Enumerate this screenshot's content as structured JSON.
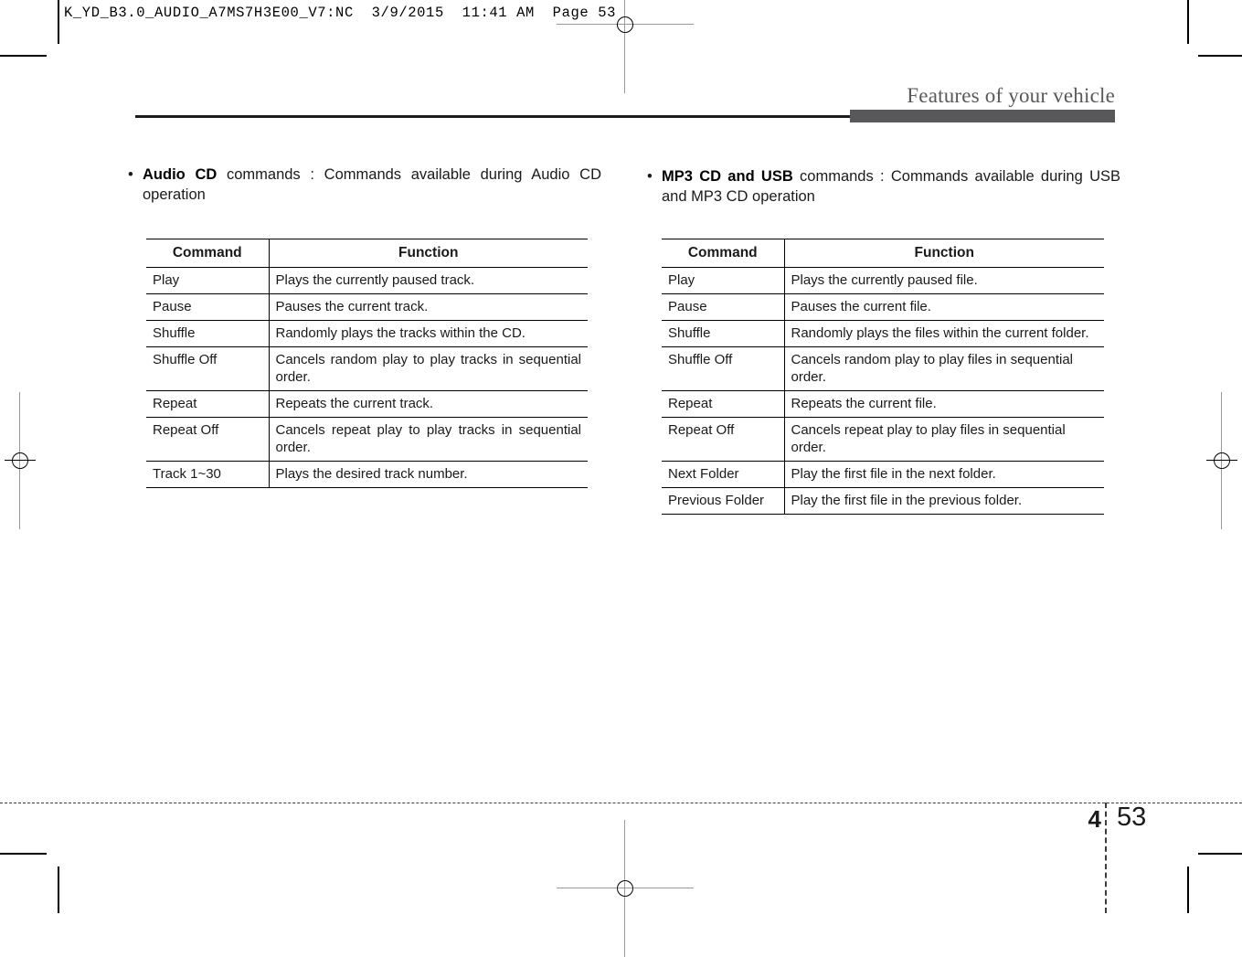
{
  "print_header": "K_YD_B3.0_AUDIO_A7MS7H3E00_V7:NC  3/9/2015  11:41 AM  Page 53",
  "running_head": "Features of your vehicle",
  "footer": {
    "chapter": "4",
    "page": "53"
  },
  "columns": {
    "left": {
      "bullet": "•",
      "lead": "Audio CD",
      "intro_rest": " commands : Commands available during Audio CD operation",
      "intro_full": "Audio CD commands : Commands available during Audio CD operation",
      "table": {
        "headers": [
          "Command",
          "Function"
        ],
        "rows": [
          [
            "Play",
            "Plays the currently paused track."
          ],
          [
            "Pause",
            "Pauses the current track."
          ],
          [
            "Shuffle",
            "Randomly plays the tracks within the CD."
          ],
          [
            "Shuffle Off",
            "Cancels random play to play tracks in sequential order."
          ],
          [
            "Repeat",
            "Repeats the current track."
          ],
          [
            "Repeat Off",
            "Cancels repeat play to play tracks in sequential order."
          ],
          [
            "Track 1~30",
            "Plays the desired track number."
          ]
        ]
      }
    },
    "right": {
      "bullet": "•",
      "lead": "MP3 CD and USB",
      "intro_rest": " commands : Commands available during USB and MP3 CD operation",
      "intro_full": "MP3 CD and USB commands : Commands available during USB and MP3 CD operation",
      "table": {
        "headers": [
          "Command",
          "Function"
        ],
        "rows": [
          [
            "Play",
            "Plays the currently paused file."
          ],
          [
            "Pause",
            "Pauses the current file."
          ],
          [
            "Shuffle",
            "Randomly plays the files within the current folder."
          ],
          [
            "Shuffle Off",
            "Cancels random play to play files in sequential order."
          ],
          [
            "Repeat",
            "Repeats the current file."
          ],
          [
            "Repeat Off",
            "Cancels repeat play to play files in sequential order."
          ],
          [
            "Next Folder",
            "Play the first file in the next folder."
          ],
          [
            "Previous Folder",
            "Play the first file in the previous folder."
          ]
        ]
      }
    }
  },
  "colors": {
    "rule_dark": "#1c1c1c",
    "header_bar": "#58585a",
    "running_head_text": "#595959"
  }
}
